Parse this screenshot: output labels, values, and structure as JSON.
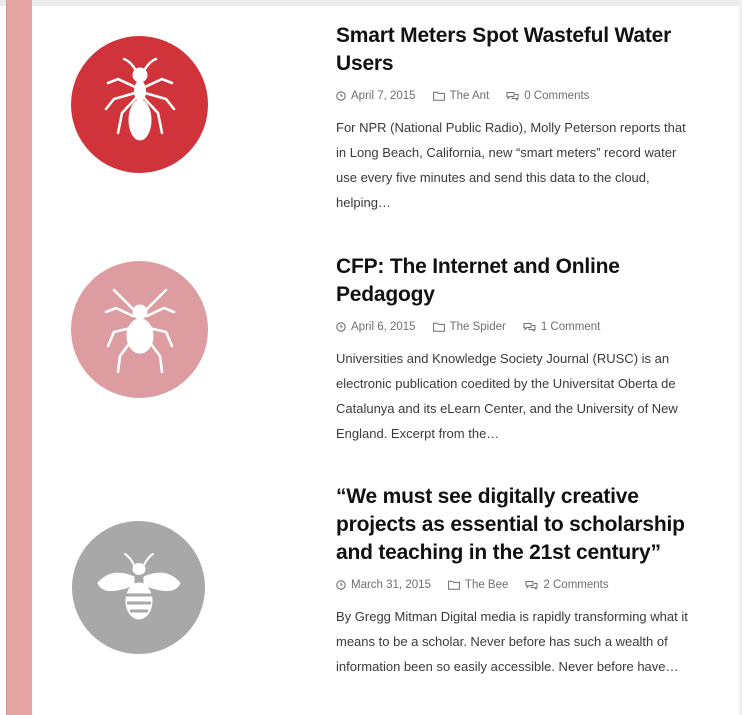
{
  "colors": {
    "sidebar_stripe": "#e6a6a6",
    "ant_circle": "#d0343a",
    "spider_circle": "#dc9ca0",
    "bee_circle": "#a8a8a8"
  },
  "posts": [
    {
      "thumbnail_icon": "ant-icon",
      "title": "Smart Meters Spot Wasteful Water Users",
      "date": "April 7, 2015",
      "category": "The Ant",
      "comments": "0 Comments",
      "excerpt": "For NPR (National Public Radio), Molly Peterson reports that in Long Beach, California, new “smart meters” record water use every five minutes and send this data to the cloud, helping…"
    },
    {
      "thumbnail_icon": "spider-icon",
      "title": "CFP: The Internet and Online Pedagogy",
      "date": "April 6, 2015",
      "category": "The Spider",
      "comments": "1 Comment",
      "excerpt": "Universities and Knowledge Society Journal (RUSC) is an electronic publication coedited by the Universitat Oberta de Catalunya and its eLearn Center, and the University of New England. Excerpt from the…"
    },
    {
      "thumbnail_icon": "bee-icon",
      "title": "“We must see digitally creative projects as essential to scholarship and teaching in the 21st century”",
      "date": "March 31, 2015",
      "category": "The Bee",
      "comments": "2 Comments",
      "excerpt": "By Gregg Mitman Digital media is rapidly transforming what it means to be a scholar.  Never before has such a wealth of information been so easily accessible.  Never before have…"
    }
  ]
}
